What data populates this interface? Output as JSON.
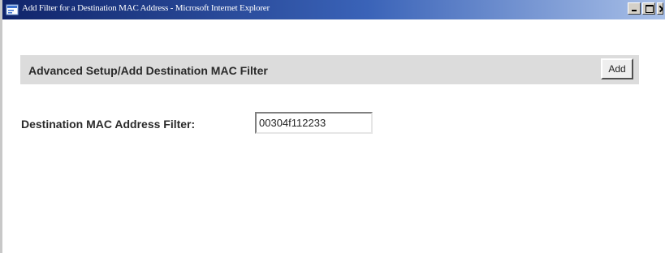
{
  "window": {
    "title": "Add Filter for a Destination MAC Address - Microsoft Internet Explorer",
    "titlebar_colors": [
      "#10246a",
      "#a9c0e8"
    ]
  },
  "form": {
    "heading": "Advanced Setup/Add Destination MAC Filter",
    "add_button_label": "Add",
    "mac_label": "Destination MAC Address Filter:",
    "mac_value": "00304f112233"
  }
}
